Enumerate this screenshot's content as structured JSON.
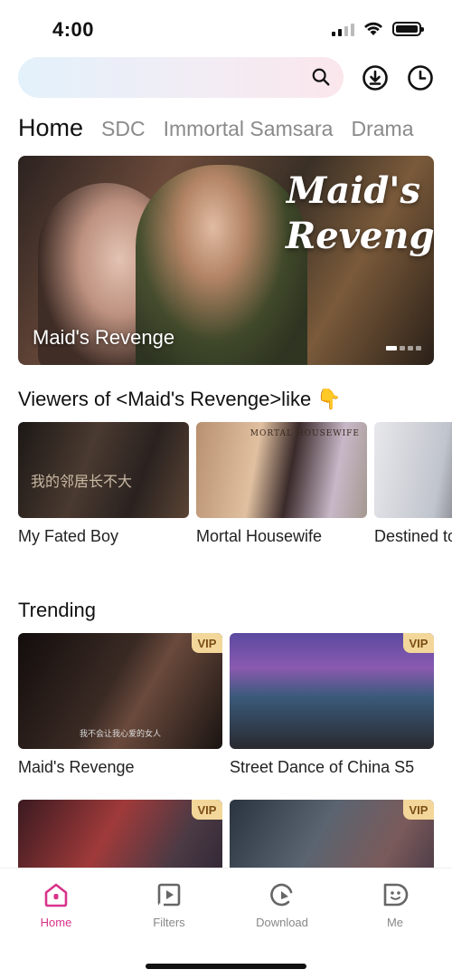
{
  "status_bar": {
    "time": "4:00"
  },
  "search": {
    "placeholder": ""
  },
  "tabs": [
    {
      "label": "Home",
      "active": true
    },
    {
      "label": "SDC"
    },
    {
      "label": "Immortal Samsara"
    },
    {
      "label": "Drama"
    }
  ],
  "banner": {
    "title_art_line1": "Maid's",
    "title_art_line2": "Revenge",
    "caption": "Maid's Revenge",
    "page_count": 4,
    "current_page": 1
  },
  "recommendations": {
    "title": "Viewers of <Maid's Revenge>like 👇",
    "items": [
      {
        "label": "My Fated Boy",
        "overlay": "我的邻居长不大"
      },
      {
        "label": "Mortal Housewife",
        "overlay": "MORTAL HOUSEWIFE"
      },
      {
        "label": "Destined to"
      }
    ]
  },
  "trending": {
    "title": "Trending",
    "badge": "VIP",
    "items": [
      {
        "label": "Maid's Revenge",
        "badge": "VIP",
        "subtitle": "我不会让我心爱的女人"
      },
      {
        "label": "Street Dance of China S5",
        "badge": "VIP"
      },
      {
        "label": "",
        "badge": "VIP"
      },
      {
        "label": "",
        "badge": "VIP"
      }
    ]
  },
  "bottom_nav": [
    {
      "label": "Home",
      "icon": "home-icon",
      "active": true
    },
    {
      "label": "Filters",
      "icon": "filters-icon"
    },
    {
      "label": "Download",
      "icon": "download-icon"
    },
    {
      "label": "Me",
      "icon": "me-icon"
    }
  ],
  "colors": {
    "accent": "#d8338a",
    "vip_bg": "#f3d79a",
    "vip_text": "#7a4d14"
  }
}
